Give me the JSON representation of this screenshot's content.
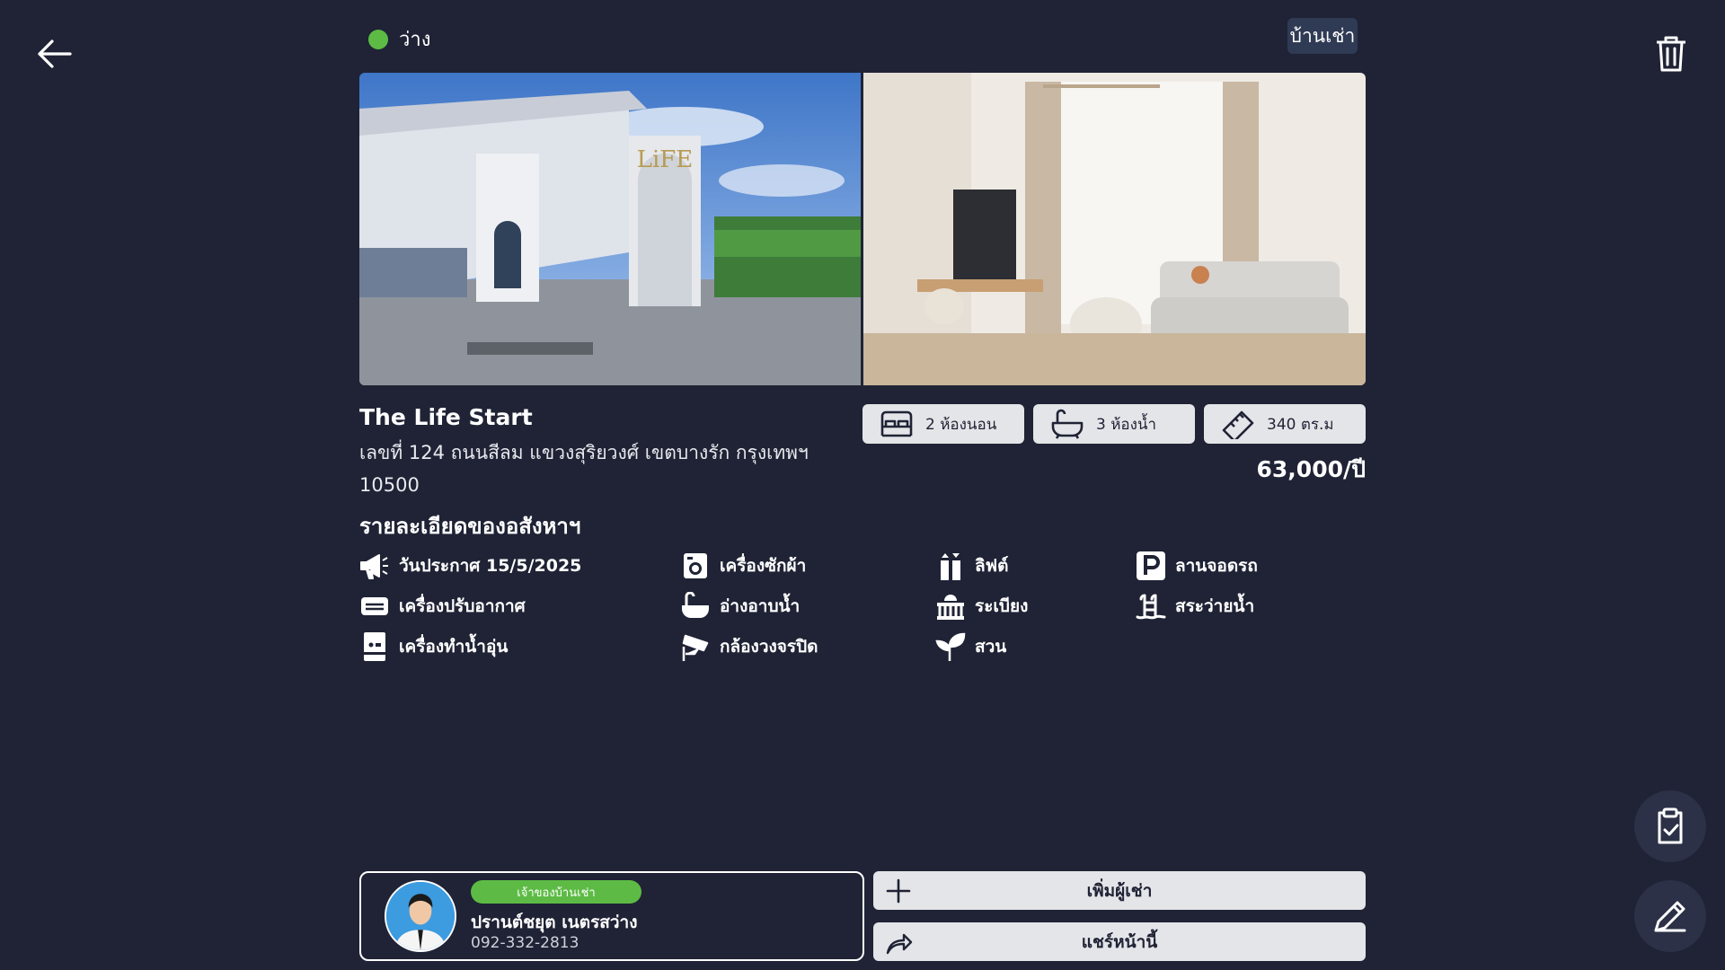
{
  "header": {
    "status_label": "ว่าง",
    "status_color": "#5dbb45",
    "property_type": "บ้านเช่า",
    "back_icon": "arrow-left-icon",
    "delete_icon": "trash-icon"
  },
  "property": {
    "name": "The Life Start",
    "address": "เลขที่ 124 ถนนสีลม แขวงสุริยวงศ์ เขตบางรัก กรุงเทพฯ 10500",
    "price": "63,000/ปี",
    "features": [
      {
        "icon": "bed-icon",
        "label": "2 ห้องนอน"
      },
      {
        "icon": "bathtub-icon",
        "label": "3 ห้องน้ำ"
      },
      {
        "icon": "ruler-icon",
        "label": "340 ตร.ม"
      }
    ]
  },
  "details": {
    "title": "รายละเอียดของอสังหาฯ",
    "items": [
      {
        "icon": "megaphone-icon",
        "label": "วันประกาศ 15/5/2025"
      },
      {
        "icon": "washing-machine-icon",
        "label": "เครื่องซักผ้า"
      },
      {
        "icon": "elevator-icon",
        "label": "ลิฟต์"
      },
      {
        "icon": "parking-icon",
        "label": "ลานจอดรถ"
      },
      {
        "icon": "air-conditioner-icon",
        "label": "เครื่องปรับอากาศ"
      },
      {
        "icon": "bathtub-icon",
        "label": "อ่างอาบน้ำ"
      },
      {
        "icon": "balcony-icon",
        "label": "ระเบียง"
      },
      {
        "icon": "pool-ladder-icon",
        "label": "สระว่ายน้ำ"
      },
      {
        "icon": "water-heater-icon",
        "label": "เครื่องทำน้ำอุ่น"
      },
      {
        "icon": "cctv-icon",
        "label": "กล้องวงจรปิด"
      },
      {
        "icon": "plant-icon",
        "label": "สวน"
      }
    ]
  },
  "owner": {
    "badge": "เจ้าของบ้านเช่า",
    "name": "ปรานต์ชยุต เนตรสว่าง",
    "phone": "092-332-2813"
  },
  "actions": {
    "add_tenant": "เพิ่มผู้เช่า",
    "share": "แชร์หน้านี้"
  }
}
